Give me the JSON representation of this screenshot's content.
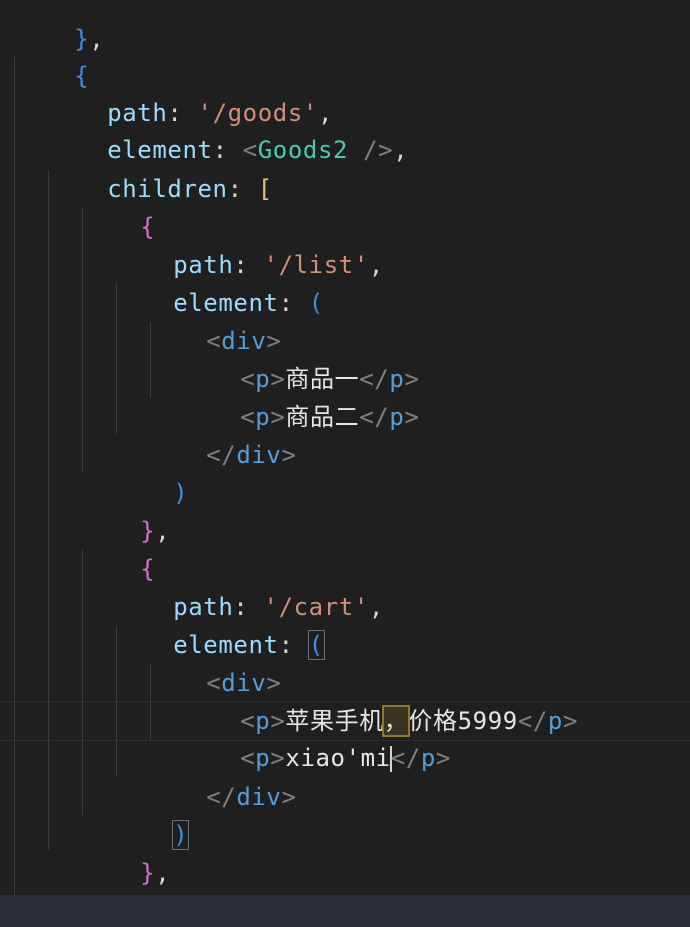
{
  "code": {
    "l00": {
      "brace": "}",
      "comma": ","
    },
    "l01": {
      "brace": "{"
    },
    "l02": {
      "key": "path",
      "colon": ":",
      "value": "'/goods'",
      "comma": ","
    },
    "l03": {
      "key": "element",
      "colon": ":",
      "lt": "<",
      "comp": "Goods2",
      "end": " />",
      "comma": ","
    },
    "l04": {
      "key": "children",
      "colon": ":",
      "bracket": "["
    },
    "l05": {
      "brace": "{"
    },
    "l06": {
      "key": "path",
      "colon": ":",
      "value": "'/list'",
      "comma": ","
    },
    "l07": {
      "key": "element",
      "colon": ":",
      "paren": "("
    },
    "l08": {
      "open": "<",
      "tag": "div",
      "close": ">"
    },
    "l09": {
      "o1": "<",
      "t1": "p",
      "c1": ">",
      "text": "商品一",
      "o2": "</",
      "t2": "p",
      "c2": ">"
    },
    "l10": {
      "o1": "<",
      "t1": "p",
      "c1": ">",
      "text": "商品二",
      "o2": "</",
      "t2": "p",
      "c2": ">"
    },
    "l11": {
      "open": "</",
      "tag": "div",
      "close": ">"
    },
    "l12": {
      "paren": ")"
    },
    "l13": {
      "brace": "}",
      "comma": ","
    },
    "l14": {
      "brace": "{"
    },
    "l15": {
      "key": "path",
      "colon": ":",
      "value": "'/cart'",
      "comma": ","
    },
    "l16": {
      "key": "element",
      "colon": ":",
      "paren": "("
    },
    "l17": {
      "open": "<",
      "tag": "div",
      "close": ">"
    },
    "l18": {
      "o1": "<",
      "t1": "p",
      "c1": ">",
      "text_a": "苹果手机",
      "text_b": "，",
      "text_c": "价格5999",
      "o2": "</",
      "t2": "p",
      "c2": ">"
    },
    "l19": {
      "o1": "<",
      "t1": "p",
      "c1": ">",
      "text": "xiao'mi",
      "o2": "</",
      "t2": "p",
      "c2": ">"
    },
    "l20": {
      "open": "</",
      "tag": "div",
      "close": ">"
    },
    "l21": {
      "paren": ")"
    },
    "l22": {
      "brace": "}",
      "comma": ","
    },
    "l23": {
      "bracket": "]"
    },
    "l24": {
      "brace": "}"
    }
  },
  "colors": {
    "background": "#1f1f1f",
    "keyword": "#9cdcfe",
    "string": "#ce9178",
    "bracket_level1": "#3b8eea",
    "bracket_level2": "#d670d6",
    "bracket_level3": "#e5c07b",
    "tag_name": "#569cd6",
    "component": "#4ec9b0"
  }
}
